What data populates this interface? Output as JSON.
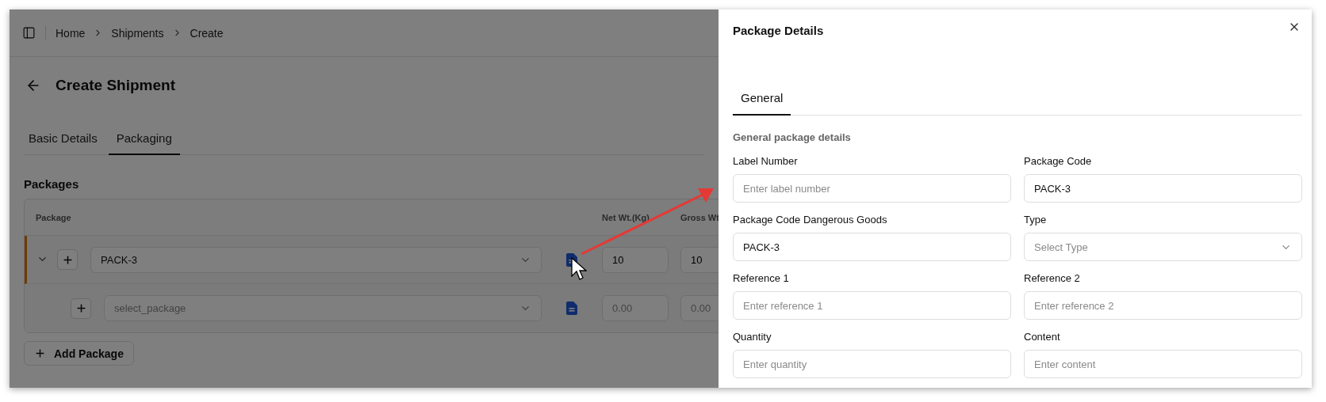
{
  "breadcrumb": [
    "Home",
    "Shipments",
    "Create"
  ],
  "page_title": "Create Shipment",
  "tabs": [
    {
      "label": "Basic Details",
      "selected": false
    },
    {
      "label": "Packaging",
      "selected": true
    }
  ],
  "section_title": "Packages",
  "table": {
    "columns": [
      "Package",
      "Net Wt.(Kg)",
      "Gross Wt"
    ],
    "rows": [
      {
        "kind": "parent",
        "selected": true,
        "expanded": true,
        "package": {
          "value": "PACK-3"
        },
        "net": {
          "value": "10"
        },
        "gross": {
          "value": "10"
        }
      },
      {
        "kind": "child",
        "selected": false,
        "package": {
          "placeholder": "select_package"
        },
        "net": {
          "placeholder": "0.00"
        },
        "gross": {
          "placeholder": "0.00"
        }
      }
    ]
  },
  "add_button": "Add Package",
  "drawer": {
    "title": "Package Details",
    "tabs": [
      {
        "label": "General",
        "selected": true
      }
    ],
    "section_title": "General package details",
    "fields": [
      {
        "label": "Label Number",
        "kind": "text",
        "placeholder": "Enter label number"
      },
      {
        "label": "Package Code",
        "kind": "text",
        "value": "PACK-3"
      },
      {
        "label": "Package Code Dangerous Goods",
        "kind": "text",
        "value": "PACK-3"
      },
      {
        "label": "Type",
        "kind": "select",
        "placeholder": "Select Type"
      },
      {
        "label": "Reference 1",
        "kind": "text",
        "placeholder": "Enter reference 1"
      },
      {
        "label": "Reference 2",
        "kind": "text",
        "placeholder": "Enter reference 2"
      },
      {
        "label": "Quantity",
        "kind": "text",
        "placeholder": "Enter quantity"
      },
      {
        "label": "Content",
        "kind": "text",
        "placeholder": "Enter content"
      }
    ]
  }
}
